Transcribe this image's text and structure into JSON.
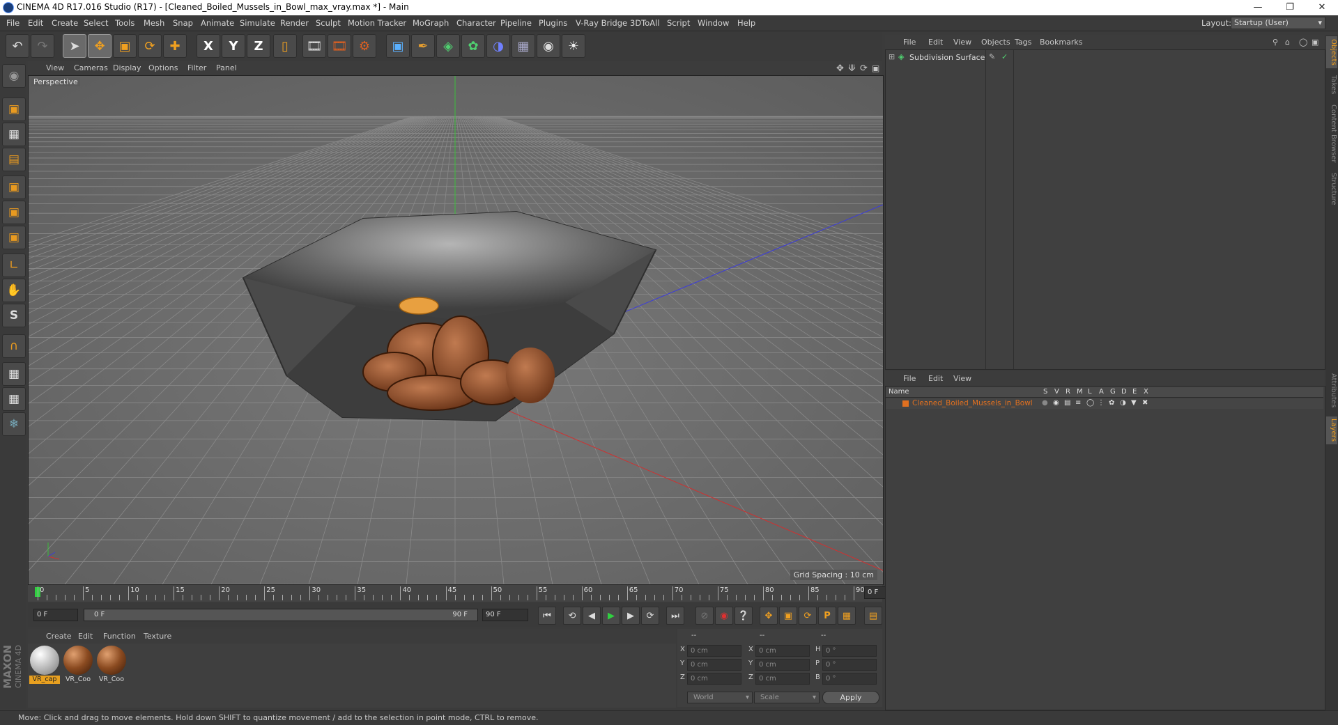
{
  "window": {
    "title": "CINEMA 4D R17.016 Studio (R17) - [Cleaned_Boiled_Mussels_in_Bowl_max_vray.max *] - Main",
    "controls": [
      "minimize-icon",
      "restore-icon",
      "close-icon"
    ]
  },
  "menubar": {
    "items": [
      "File",
      "Edit",
      "Create",
      "Select",
      "Tools",
      "Mesh",
      "Snap",
      "Animate",
      "Simulate",
      "Render",
      "Sculpt",
      "Motion Tracker",
      "MoGraph",
      "Character",
      "Pipeline",
      "Plugins",
      "V-Ray Bridge",
      "3DToAll",
      "Script",
      "Window",
      "Help"
    ],
    "layout_label": "Layout:",
    "layout_value": "Startup (User)"
  },
  "toolbar": {
    "icons": [
      "undo-icon",
      "redo-icon",
      "live-selection-icon",
      "move-icon",
      "scale-icon",
      "rotate-icon",
      "add-move-icon",
      "x-axis-lock-icon",
      "y-axis-lock-icon",
      "z-axis-lock-icon",
      "coordinate-system-icon",
      "render-view-icon",
      "render-picture-viewer-icon",
      "edit-render-settings-icon",
      "cube-icon",
      "pen-spline-icon",
      "subdivision-surface-icon",
      "array-icon",
      "deformer-icon",
      "floor-icon",
      "camera-icon",
      "light-icon"
    ],
    "axis_labels": [
      "X",
      "Y",
      "Z"
    ]
  },
  "leftbar": {
    "icons": [
      "make-editable-icon",
      "model-mode-icon",
      "texture-mode-icon",
      "workplane-icon",
      "points-mode-icon",
      "edges-mode-icon",
      "polygons-mode-icon",
      "axis-mode-icon",
      "tweak-mode-icon",
      "solo-mode-icon",
      "snap-magnet-icon",
      "grid-lock-icon",
      "grid-snap-icon",
      "python-icon"
    ],
    "solo_letter": "S"
  },
  "viewport": {
    "menu": [
      "View",
      "Cameras",
      "Display",
      "Options",
      "Filter",
      "Panel"
    ],
    "label": "Perspective",
    "grid_spacing": "Grid Spacing : 10 cm",
    "nav_icons": [
      "pan-icon",
      "dolly-icon",
      "orbit-icon",
      "maximize-icon"
    ]
  },
  "timeline": {
    "ticks": [
      "0",
      "5",
      "10",
      "15",
      "20",
      "25",
      "30",
      "35",
      "40",
      "45",
      "50",
      "55",
      "60",
      "65",
      "70",
      "75",
      "80",
      "85",
      "90"
    ],
    "current_frame": "0 F",
    "start_field": "0 F",
    "range_start": "0 F",
    "range_end": "90 F",
    "end_field": "90 F",
    "play_icons": [
      "goto-start-icon",
      "prev-key-icon",
      "prev-frame-icon",
      "play-icon",
      "next-frame-icon",
      "next-key-icon",
      "goto-end-icon"
    ],
    "record_icons": [
      "record-off-icon",
      "record-icon",
      "autokey-icon",
      "key-position-icon",
      "key-scale-icon",
      "key-rotation-icon",
      "key-param-icon",
      "key-pla-icon",
      "timeline-icon"
    ],
    "param_letter": "P"
  },
  "materials": {
    "menu": [
      "Create",
      "Edit",
      "Function",
      "Texture"
    ],
    "items": [
      {
        "label": "VR_cap",
        "color": "#c9c9c9",
        "selected": true
      },
      {
        "label": "VR_Coo",
        "color": "#8a4a20",
        "selected": false
      },
      {
        "label": "VR_Coo",
        "color": "#8a4a20",
        "selected": false
      }
    ]
  },
  "coordinates": {
    "headers": [
      "--",
      "--",
      "--"
    ],
    "rows": [
      {
        "a": "X",
        "av": "0 cm",
        "b": "X",
        "bv": "0 cm",
        "c": "H",
        "cv": "0 °"
      },
      {
        "a": "Y",
        "av": "0 cm",
        "b": "Y",
        "bv": "0 cm",
        "c": "P",
        "cv": "0 °"
      },
      {
        "a": "Z",
        "av": "0 cm",
        "b": "Z",
        "bv": "0 cm",
        "c": "B",
        "cv": "0 °"
      }
    ],
    "mode1": "World",
    "mode2": "Scale",
    "apply": "Apply"
  },
  "objects": {
    "menu": [
      "File",
      "Edit",
      "View",
      "Objects",
      "Tags",
      "Bookmarks"
    ],
    "item": "Subdivision Surface"
  },
  "layers": {
    "menu": [
      "File",
      "Edit",
      "View"
    ],
    "columns": [
      "Name",
      "S",
      "V",
      "R",
      "M",
      "L",
      "A",
      "G",
      "D",
      "E",
      "X"
    ],
    "item": "Cleaned_Boiled_Mussels_in_Bowl",
    "item_color": "#e07020"
  },
  "sidetabs": [
    "Objects",
    "Takes",
    "Content Browser",
    "Structure",
    "Attributes",
    "Layers"
  ],
  "brand": {
    "maxon": "MAXON",
    "cinema": "CINEMA 4D"
  },
  "status": "Move: Click and drag to move elements. Hold down SHIFT to quantize movement / add to the selection in point mode, CTRL to remove."
}
